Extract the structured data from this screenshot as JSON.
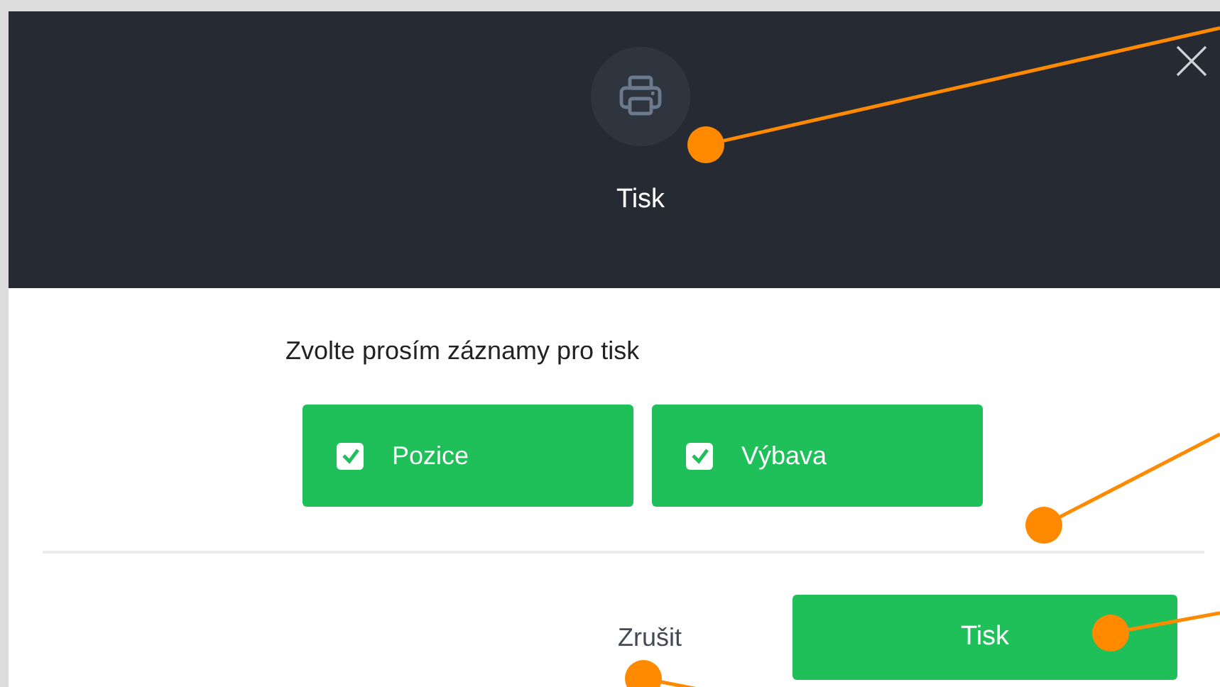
{
  "dialog": {
    "title": "Tisk",
    "prompt": "Zvolte prosím záznamy pro tisk",
    "options": [
      {
        "label": "Pozice",
        "checked": true
      },
      {
        "label": "Výbava",
        "checked": true
      }
    ],
    "cancel": "Zrušit",
    "confirm": "Tisk"
  }
}
